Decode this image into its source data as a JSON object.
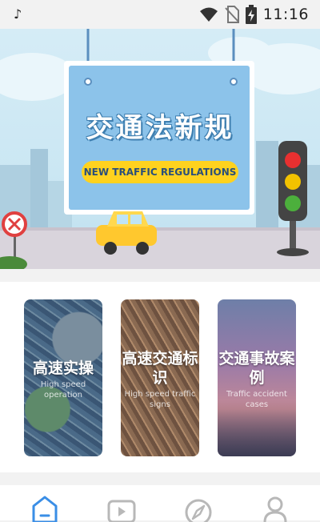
{
  "status_bar": {
    "time": "11:16",
    "icons": [
      "tiktok-icon",
      "wifi-icon",
      "no-sim-icon",
      "battery-charging-icon"
    ]
  },
  "banner": {
    "title": "交通法新规",
    "subtitle": "NEW TRAFFIC REGULATIONS"
  },
  "cards": [
    {
      "title": "高速实操",
      "subtitle": "High speed operation"
    },
    {
      "title": "高速交通标识",
      "subtitle": "High speed traffic signs"
    },
    {
      "title": "交通事故案例",
      "subtitle": "Traffic accident cases"
    }
  ],
  "nav": {
    "tabs": [
      {
        "icon": "home-icon",
        "active": true
      },
      {
        "icon": "video-icon",
        "active": false
      },
      {
        "icon": "compass-icon",
        "active": false
      },
      {
        "icon": "user-icon",
        "active": false
      }
    ],
    "active_color": "#3a8ee6",
    "inactive_color": "#b8b8b8"
  }
}
